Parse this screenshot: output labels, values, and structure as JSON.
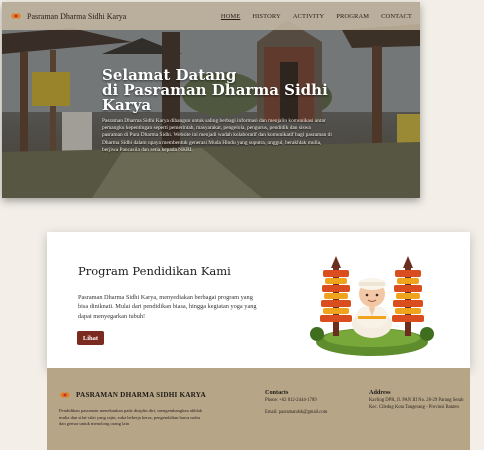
{
  "nav": {
    "brand": "Pasraman Dharma Sidhi Karya",
    "links": [
      "HOME",
      "HISTORY",
      "ACTIVITY",
      "PROGRAM",
      "CONTACT"
    ],
    "active": "HOME"
  },
  "hero": {
    "title_line1": "Selamat Datang",
    "title_line2": "di Pasraman Dharma Sidhi",
    "title_line3": "Karya",
    "body": "Pasraman Dharma Sidhi Karya dibangun untuk saling berbagi informasi dan menjalin komunikasi antar pemangku kepentingan seperti pemerintah, masyarakat, pengelola, pengurus, pendidik dan siswa pasraman di Pura Dharma Sidhi. Website ini menjadi wadah kolaboratif dan komunikatif bagi pasraman di Dharma Sidhi dalam upaya membentuk generasi Muda Hindu yang suputra, unggul, berakhlak mulia, berjiwa Pancasila dan setia kepada NKRI."
  },
  "program": {
    "title": "Program Pendidikan Kami",
    "text": "Pasraman Dharma Sidhi Karya, menyediakan berbagai program yang bisa diniknati. Mulai dari pendidikan biasa, hingga kegiatan yoga yang dapat menyegarkan tubuh!",
    "button": "Lihat"
  },
  "footer": {
    "brand": "PASRAMAN DHARMA SIDHI KARYA",
    "description": "Pendidikan pasraman menekankan pada disiplin diri, mengembangkan akhlak mulia dan sifat-sifat yang rajin, suka bekerja keras, pengendalian hawa nafsu dan gemar untuk menolong orang lain",
    "contacts_title": "Contacts",
    "phone": "Phone: +62 812-2444-1789",
    "email": "Email: pasramandsk@gmail.com",
    "address_title": "Address",
    "address": "Kavling DPR, Jl. PAN III No. 28-29 Parung Serab Kec. Ciledug Kota Tangerang - Provinsi Banten"
  },
  "colors": {
    "accent_button": "#7a2a1e",
    "footer_bg": "#b7a588",
    "nav_bg": "#c4b6a0",
    "logo_red": "#c0392b",
    "logo_orange": "#e67e22"
  },
  "icons": {
    "brand_logo": "om-symbol-icon",
    "illustration": "hindu-temple-character-illustration"
  }
}
